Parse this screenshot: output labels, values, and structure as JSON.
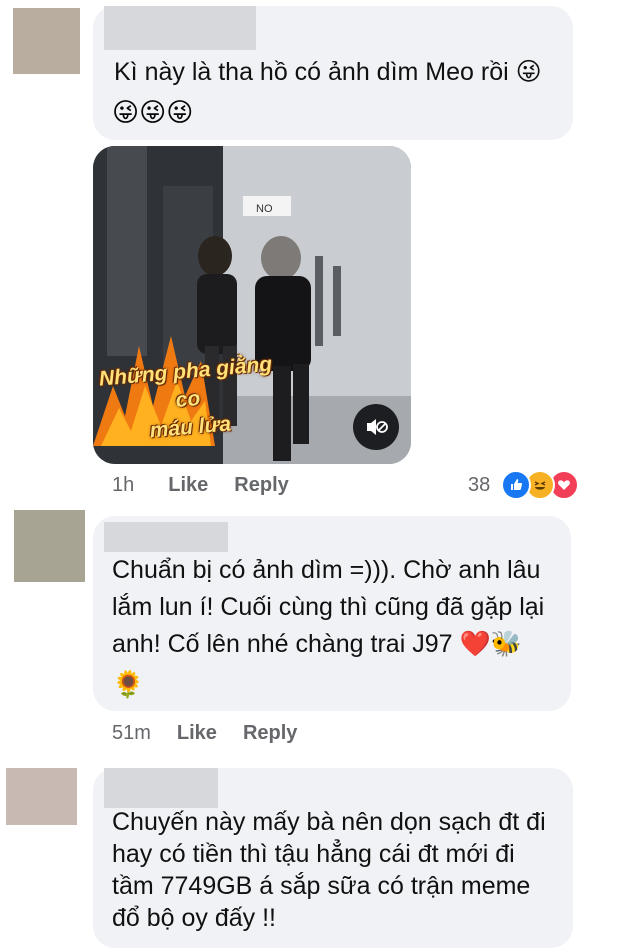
{
  "comments": [
    {
      "text": "Kì này là tha hồ có ảnh dìm Meo rồi 😜",
      "emoji_line": "😜😜😜",
      "time": "1h",
      "like_label": "Like",
      "reply_label": "Reply",
      "reaction_count": "38",
      "reaction_icons": [
        "like-icon",
        "haha-icon",
        "love-icon"
      ],
      "video": {
        "caption": "Những pha giằng co\nmáu lửa",
        "sign": "NO",
        "muted": true
      }
    },
    {
      "text": "Chuẩn bị có ảnh dìm =))). Chờ anh lâu\nlắm lun í! Cuối cùng thì cũng đã gặp lại\nanh! Cố lên nhé chàng trai J97 ❤️🐝",
      "emoji_line": "🌻",
      "time": "51m",
      "like_label": "Like",
      "reply_label": "Reply"
    },
    {
      "text": "Chuyến này mấy bà nên dọn sạch đt đi\nhay có tiền thì tậu hẳng cái đt mới đi\ntầm 7749GB á sắp sữa có trận meme\nđổ bộ oy đấy !!"
    }
  ],
  "colors": {
    "bubble": "#f0f2f5",
    "meta_text": "#65676b",
    "like_blue": "#1877f2",
    "haha_yellow": "#f7b125",
    "love_red": "#f33e58"
  }
}
